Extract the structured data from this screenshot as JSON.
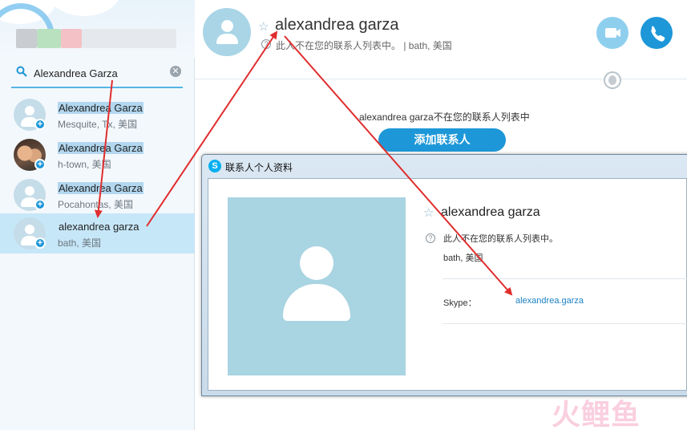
{
  "search": {
    "value": "Alexandrea Garza",
    "clear_icon": "✕"
  },
  "contacts": [
    {
      "name": "Alexandrea Garza",
      "location": "Mesquite, Tx, 美国",
      "avatar": "default"
    },
    {
      "name": "Alexandrea Garza",
      "location": "h-town, 美国",
      "avatar": "photo"
    },
    {
      "name": "Alexandrea Garza",
      "location": "Pocahontas, 美国",
      "avatar": "default"
    },
    {
      "name": "alexandrea garza",
      "location": "bath, 美国",
      "avatar": "default",
      "selected": true
    }
  ],
  "header": {
    "name": "alexandrea garza",
    "status": "此人不在您的联系人列表中。 | bath, 美国",
    "info_glyph": "?",
    "star_glyph": "☆"
  },
  "main": {
    "message": "alexandrea garza不在您的联系人列表中",
    "add_contact_label": "添加联系人"
  },
  "dialog": {
    "title": "联系人个人资料",
    "app_icon_letter": "S",
    "name": "alexandrea garza",
    "status": "此人不在您的联系人列表中。",
    "location": "bath, 美国",
    "skype_label": "Skype：",
    "skype_id": "alexandrea.garza"
  },
  "watermark": "火鲤鱼",
  "colors": {
    "accent": "#1d97d8",
    "selection": "#c6e7f8",
    "highlight": "#b2d7ef",
    "arrow": "#e02d2d"
  },
  "icons": [
    "search-icon",
    "clear-icon",
    "add-contact-badge-icon",
    "star-icon",
    "info-icon",
    "video-call-icon",
    "phone-icon",
    "globe-icon",
    "skype-logo-icon"
  ]
}
